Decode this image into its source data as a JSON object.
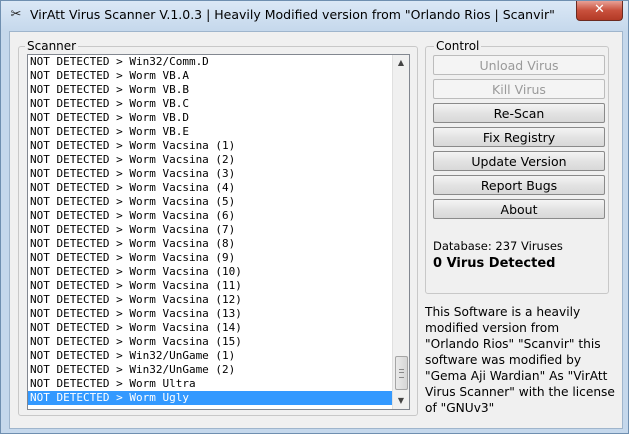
{
  "window": {
    "title": "VirAtt Virus Scanner V.1.0.3 | Heavily Modified version from \"Orlando Rios | Scanvir\"",
    "close_label": "✕"
  },
  "scanner": {
    "group_label": "Scanner",
    "items": [
      "NOT DETECTED > Win32/Comm.D",
      "NOT DETECTED > Worm VB.A",
      "NOT DETECTED > Worm VB.B",
      "NOT DETECTED > Worm VB.C",
      "NOT DETECTED > Worm VB.D",
      "NOT DETECTED > Worm VB.E",
      "NOT DETECTED > Worm Vacsina (1)",
      "NOT DETECTED > Worm Vacsina (2)",
      "NOT DETECTED > Worm Vacsina (3)",
      "NOT DETECTED > Worm Vacsina (4)",
      "NOT DETECTED > Worm Vacsina (5)",
      "NOT DETECTED > Worm Vacsina (6)",
      "NOT DETECTED > Worm Vacsina (7)",
      "NOT DETECTED > Worm Vacsina (8)",
      "NOT DETECTED > Worm Vacsina (9)",
      "NOT DETECTED > Worm Vacsina (10)",
      "NOT DETECTED > Worm Vacsina (11)",
      "NOT DETECTED > Worm Vacsina (12)",
      "NOT DETECTED > Worm Vacsina (13)",
      "NOT DETECTED > Worm Vacsina (14)",
      "NOT DETECTED > Worm Vacsina (15)",
      "NOT DETECTED > Win32/UnGame (1)",
      "NOT DETECTED > Win32/UnGame (2)",
      "NOT DETECTED > Worm Ultra",
      "NOT DETECTED > Worm Ugly"
    ],
    "selected_index": 24
  },
  "control": {
    "group_label": "Control",
    "buttons": [
      {
        "label": "Unload Virus",
        "enabled": false
      },
      {
        "label": "Kill Virus",
        "enabled": false
      },
      {
        "label": "Re-Scan",
        "enabled": true
      },
      {
        "label": "Fix Registry",
        "enabled": true
      },
      {
        "label": "Update Version",
        "enabled": true
      },
      {
        "label": "Report Bugs",
        "enabled": true
      },
      {
        "label": "About",
        "enabled": true
      }
    ],
    "database_text": "Database: 237 Viruses",
    "detected_text": "0 Virus Detected"
  },
  "about": {
    "text": "This Software is a heavily modified version from \"Orlando Rios\" \"Scanvir\" this software was modified by \"Gema Aji Wardian\" As \"VirAtt Virus Scanner\" with the license of \"GNUv3\""
  },
  "icons": {
    "app_icon": "scissors-icon",
    "scroll_up": "scroll-up-arrow-icon",
    "scroll_down": "scroll-down-arrow-icon"
  }
}
